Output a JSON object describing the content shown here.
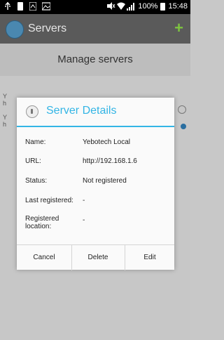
{
  "status_bar": {
    "battery": "100%",
    "time": "15:48"
  },
  "action_bar": {
    "title": "Servers",
    "add_icon": "+"
  },
  "header": {
    "title": "Manage servers"
  },
  "background_list": [
    {
      "prefix": "Y"
    },
    {
      "prefix": "h"
    },
    {
      "prefix": "Y"
    },
    {
      "prefix": "h"
    }
  ],
  "dialog": {
    "title": "Server Details",
    "fields": [
      {
        "label": "Name:",
        "value": "Yebotech Local"
      },
      {
        "label": "URL:",
        "value": "http://192.168.1.6"
      },
      {
        "label": "Status:",
        "value": "Not registered"
      },
      {
        "label": "Last registered:",
        "value": "-"
      },
      {
        "label": "Registered location:",
        "value": "-"
      }
    ],
    "buttons": {
      "cancel": "Cancel",
      "delete": "Delete",
      "edit": "Edit"
    }
  },
  "colors": {
    "accent": "#33b5e5",
    "add_green": "#7ec440"
  }
}
